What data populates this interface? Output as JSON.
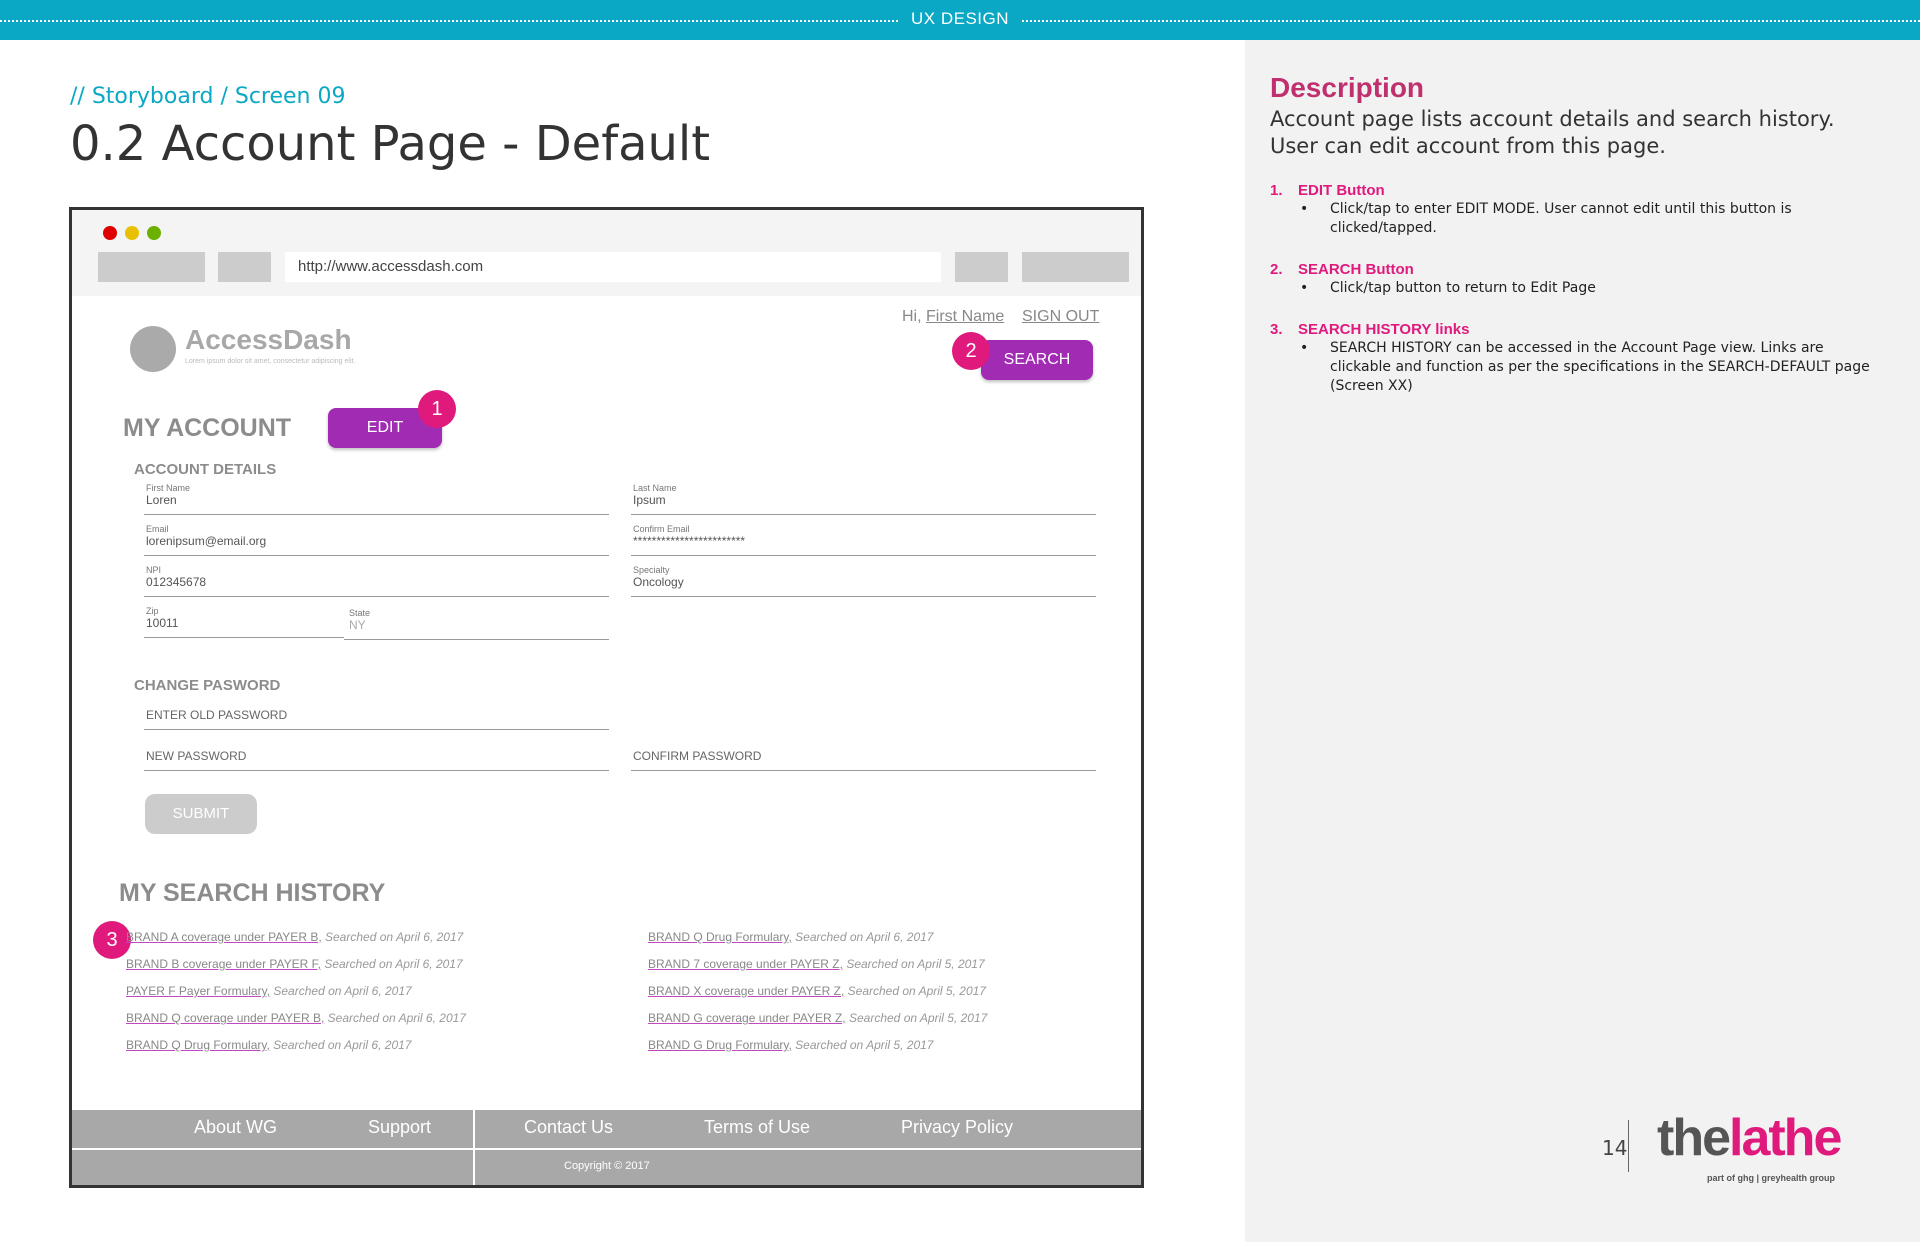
{
  "banner": {
    "label": "UX DESIGN"
  },
  "header": {
    "breadcrumb": "// Storyboard / Screen 09",
    "title": "0.2 Account Page - Default"
  },
  "browser": {
    "url": "http://www.accessdash.com",
    "app": {
      "greeting": "Hi,",
      "first_name": "First Name",
      "sign_out": "SIGN OUT",
      "brand": "AccessDash",
      "tagline": "Lorem ipsum dolor sit amet, consectetur adipiscing elit.",
      "search_button": "SEARCH",
      "edit_button": "EDIT",
      "my_account": "MY ACCOUNT",
      "account_details": "ACCOUNT DETAILS",
      "fields": [
        {
          "label": "First Name",
          "value": "Loren"
        },
        {
          "label": "Last Name",
          "value": "Ipsum"
        },
        {
          "label": "Email",
          "value": "lorenipsum@email.org"
        },
        {
          "label": "Confirm Email",
          "value": "************************"
        },
        {
          "label": "NPI",
          "value": "012345678"
        },
        {
          "label": "Specialty",
          "value": "Oncology"
        },
        {
          "label": "Zip",
          "value": "10011"
        },
        {
          "label": "State",
          "value": "NY"
        }
      ],
      "change_password": "CHANGE PASWORD",
      "password_fields": [
        "ENTER OLD PASSWORD",
        "NEW PASSWORD",
        "CONFIRM PASSWORD"
      ],
      "submit_button": "SUBMIT",
      "search_history_title": "MY SEARCH HISTORY",
      "history_left": [
        {
          "link": "BRAND A coverage under PAYER B,",
          "when": "Searched on April 6, 2017"
        },
        {
          "link": "BRAND B coverage under PAYER F,",
          "when": "Searched on April 6, 2017"
        },
        {
          "link": "PAYER F Payer Formulary,",
          "when": "Searched on April 6, 2017"
        },
        {
          "link": "BRAND Q coverage under PAYER B,",
          "when": "Searched on April 6, 2017"
        },
        {
          "link": "BRAND Q Drug Formulary,",
          "when": "Searched on April 6, 2017"
        }
      ],
      "history_right": [
        {
          "link": "BRAND Q Drug Formulary,",
          "when": "Searched on April 6, 2017"
        },
        {
          "link": "BRAND 7 coverage under PAYER Z,",
          "when": "Searched on April 5, 2017"
        },
        {
          "link": "BRAND X coverage under PAYER Z,",
          "when": "Searched on April 5, 2017"
        },
        {
          "link": "BRAND G coverage under PAYER Z,",
          "when": "Searched on April 5, 2017"
        },
        {
          "link": "BRAND G Drug Formulary,",
          "when": "Searched on April 5, 2017"
        }
      ],
      "footer_links": [
        "About WG",
        "Support",
        "Contact Us",
        "Terms of Use",
        "Privacy Policy"
      ],
      "copyright": "Copyright © 2017"
    }
  },
  "badges": [
    "1",
    "2",
    "3"
  ],
  "description": {
    "title": "Description",
    "body": "Account page lists account details and search history. User can edit account from this page.",
    "notes": [
      {
        "num": "1.",
        "title": "EDIT Button",
        "body": "Click/tap to enter EDIT MODE. User cannot edit until this button is clicked/tapped."
      },
      {
        "num": "2.",
        "title": "SEARCH Button",
        "body": "Click/tap button to return to Edit Page"
      },
      {
        "num": "3.",
        "title": "SEARCH HISTORY links",
        "body": "SEARCH HISTORY can be accessed in the Account Page view. Links are clickable and function as per the specifications in the SEARCH-DEFAULT page (Screen XX)"
      }
    ],
    "bullet": "•"
  },
  "page_number": "14",
  "logo": {
    "the": "the",
    "lathe": "lathe",
    "sub": "part of ghg | greyhealth group"
  },
  "colors": {
    "banner": "#0aa8c4",
    "accent_magenta": "#e0197d",
    "button_purple": "#a12bb3",
    "title_pink": "#c0306f"
  }
}
